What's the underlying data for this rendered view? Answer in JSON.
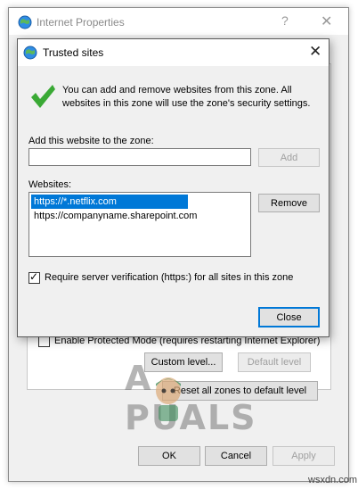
{
  "outer_window": {
    "title": "Internet Properties",
    "help_glyph": "?",
    "close_glyph": "✕",
    "protected_mode_label": "Enable Protected Mode (requires restarting Internet Explorer)",
    "protected_mode_checked": false,
    "custom_level_label": "Custom level...",
    "default_level_label": "Default level",
    "reset_all_label": "Reset all zones to default level",
    "ok_label": "OK",
    "cancel_label": "Cancel",
    "apply_label": "Apply"
  },
  "dialog": {
    "title": "Trusted sites",
    "close_glyph": "✕",
    "info_text": "You can add and remove websites from this zone. All websites in this zone will use the zone's security settings.",
    "add_label": "Add this website to the zone:",
    "add_input_value": "",
    "add_button_label": "Add",
    "websites_label": "Websites:",
    "websites": [
      "https://*.netflix.com",
      "https://companyname.sharepoint.com"
    ],
    "selected_index": 0,
    "remove_button_label": "Remove",
    "require_verification_label": "Require server verification (https:) for all sites in this zone",
    "require_verification_checked": true,
    "close_button_label": "Close"
  },
  "watermark": {
    "text_left": "A",
    "text_right": "PUALS",
    "site": "wsxdn.com"
  },
  "colors": {
    "accent": "#0078d7",
    "checkmark_green": "#3aa935"
  },
  "icons": {
    "window_icon": "globe-icon",
    "info_icon": "checkmark-icon"
  }
}
